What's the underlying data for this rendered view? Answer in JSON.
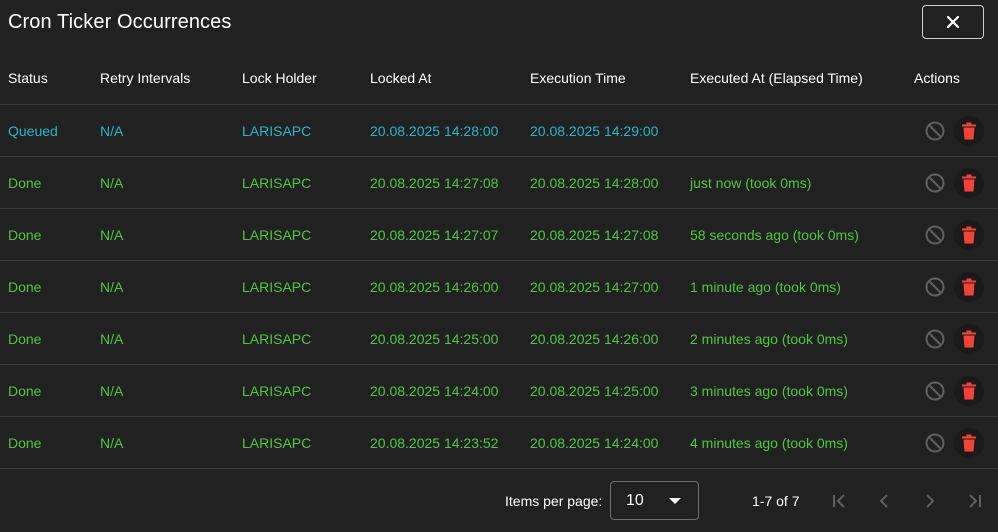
{
  "dialog": {
    "title": "Cron Ticker Occurrences",
    "close_label": "✕"
  },
  "table": {
    "headers": {
      "status": "Status",
      "retry": "Retry Intervals",
      "lock_holder": "Lock Holder",
      "locked_at": "Locked At",
      "execution_time": "Execution Time",
      "executed_at": "Executed At (Elapsed Time)",
      "actions": "Actions"
    },
    "rows": [
      {
        "status": "Queued",
        "retry": "N/A",
        "lock_holder": "LARISAPC",
        "locked_at": "20.08.2025 14:28:00",
        "execution_time": "20.08.2025 14:29:00",
        "executed_at": "",
        "color": "#26b6cf"
      },
      {
        "status": "Done",
        "retry": "N/A",
        "lock_holder": "LARISAPC",
        "locked_at": "20.08.2025 14:27:08",
        "execution_time": "20.08.2025 14:28:00",
        "executed_at": "just now (took 0ms)",
        "color": "#4cc93f"
      },
      {
        "status": "Done",
        "retry": "N/A",
        "lock_holder": "LARISAPC",
        "locked_at": "20.08.2025 14:27:07",
        "execution_time": "20.08.2025 14:27:08",
        "executed_at": "58 seconds ago (took 0ms)",
        "color": "#4cc93f"
      },
      {
        "status": "Done",
        "retry": "N/A",
        "lock_holder": "LARISAPC",
        "locked_at": "20.08.2025 14:26:00",
        "execution_time": "20.08.2025 14:27:00",
        "executed_at": "1 minute ago (took 0ms)",
        "color": "#4cc93f"
      },
      {
        "status": "Done",
        "retry": "N/A",
        "lock_holder": "LARISAPC",
        "locked_at": "20.08.2025 14:25:00",
        "execution_time": "20.08.2025 14:26:00",
        "executed_at": "2 minutes ago (took 0ms)",
        "color": "#4cc93f"
      },
      {
        "status": "Done",
        "retry": "N/A",
        "lock_holder": "LARISAPC",
        "locked_at": "20.08.2025 14:24:00",
        "execution_time": "20.08.2025 14:25:00",
        "executed_at": "3 minutes ago (took 0ms)",
        "color": "#4cc93f"
      },
      {
        "status": "Done",
        "retry": "N/A",
        "lock_holder": "LARISAPC",
        "locked_at": "20.08.2025 14:23:52",
        "execution_time": "20.08.2025 14:24:00",
        "executed_at": "4 minutes ago (took 0ms)",
        "color": "#4cc93f"
      }
    ],
    "row_icons": {
      "cancel": "cancel-icon",
      "delete": "delete-icon"
    }
  },
  "pagination": {
    "items_per_page_label": "Items per page:",
    "items_per_page_value": "10",
    "range_label": "1-7 of 7",
    "icons": [
      "first-page-icon",
      "previous-page-icon",
      "next-page-icon",
      "last-page-icon"
    ]
  },
  "colors": {
    "background": "#212121",
    "queued": "#26b6cf",
    "done": "#4cc93f",
    "delete": "#f44336",
    "disabled_icon": "#5f5f5f"
  }
}
